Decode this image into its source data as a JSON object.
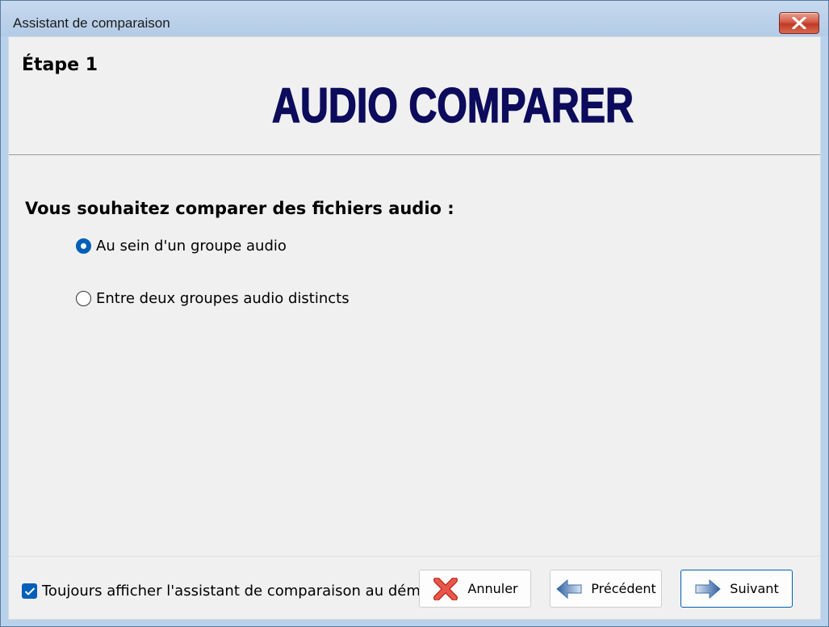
{
  "window": {
    "title": "Assistant de comparaison"
  },
  "header": {
    "step": "Étape 1",
    "logo_text": "AUDIO COMPARER"
  },
  "main": {
    "question": "Vous souhaitez comparer des fichiers audio :",
    "options": [
      {
        "label": "Au sein d'un groupe audio",
        "selected": true
      },
      {
        "label": "Entre deux groupes audio distincts",
        "selected": false
      }
    ]
  },
  "footer": {
    "always_show_label": "Toujours afficher l'assistant de comparaison au démarrage",
    "always_show_checked": true,
    "buttons": {
      "cancel": "Annuler",
      "previous": "Précédent",
      "next": "Suivant"
    }
  },
  "icons": {
    "close": "close-icon",
    "cancel": "red-x-icon",
    "previous": "arrow-left-icon",
    "next": "arrow-right-icon",
    "check": "checkmark-icon"
  },
  "colors": {
    "logo": "#0d0b5c",
    "accent": "#005fb8",
    "close_button": "#c8432c",
    "cancel_icon": "#e0463a",
    "arrow_icon": "#3d6fb0"
  }
}
